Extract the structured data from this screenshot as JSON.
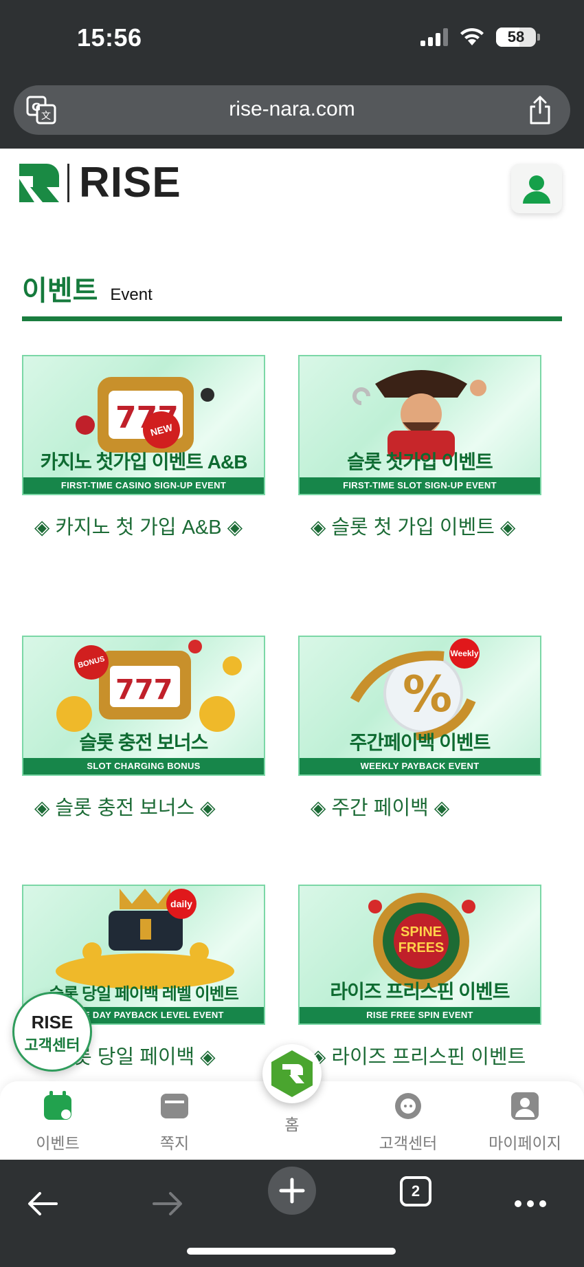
{
  "status_bar": {
    "time": "15:56",
    "battery": "58"
  },
  "browser": {
    "url": "rise-nara.com"
  },
  "site": {
    "logo_text": "RISE"
  },
  "section": {
    "title_ko": "이벤트",
    "title_en": "Event"
  },
  "events": [
    {
      "banner_title": "카지노 첫가입 이벤트 A&B",
      "banner_subtitle": "FIRST-TIME CASINO SIGN-UP EVENT",
      "badge": "NEW",
      "label": "◈ 카지노 첫 가입 A&B ◈"
    },
    {
      "banner_title": "슬롯 첫가입 이벤트",
      "banner_subtitle": "FIRST-TIME SLOT SIGN-UP EVENT",
      "badge": "",
      "label": "◈ 슬롯 첫 가입 이벤트 ◈"
    },
    {
      "banner_title": "슬롯 충전 보너스",
      "banner_subtitle": "SLOT CHARGING BONUS",
      "badge": "BONUS",
      "label": "◈ 슬롯 충전 보너스 ◈"
    },
    {
      "banner_title": "주간페이백 이벤트",
      "banner_subtitle": "WEEKLY PAYBACK EVENT",
      "badge": "Weekly",
      "label": "◈ 주간 페이백 ◈"
    },
    {
      "banner_title": "슬롯 당일 페이백 레벨 이벤트",
      "banner_subtitle": "SAME DAY PAYBACK LEVEL EVENT",
      "badge": "daily",
      "label": "◈ 슬롯 당일 페이백 ◈"
    },
    {
      "banner_title": "라이즈 프리스핀 이벤트",
      "banner_subtitle": "RISE FREE SPIN EVENT",
      "badge": "SPINE FREES",
      "label": "◈ 라이즈 프리스핀 이벤트 ◈"
    }
  ],
  "customer_center_badge": {
    "brand": "RISE",
    "label": "고객센터"
  },
  "bottom_nav": {
    "events": "이벤트",
    "messages": "쪽지",
    "home": "홈",
    "support": "고객센터",
    "mypage": "마이페이지"
  },
  "toolbar": {
    "tab_count": "2"
  },
  "colors": {
    "brand_green": "#1a7d3f",
    "text_green": "#1c6b36",
    "chrome": "#2e3133"
  }
}
